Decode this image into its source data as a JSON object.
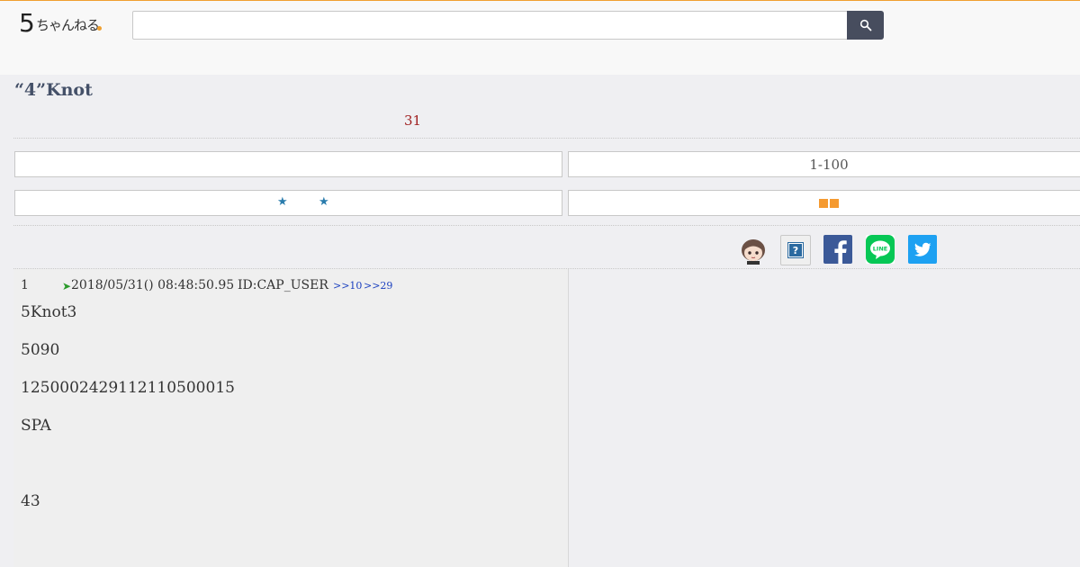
{
  "header": {
    "logo_five": "5",
    "logo_text": "ちゃんねる",
    "search_placeholder": "",
    "search_icon": "search-icon"
  },
  "thread": {
    "title": "“4”Knot",
    "count": "31"
  },
  "nav": {
    "range_label": "1-100",
    "left_box_top_label": "",
    "left_box_bottom_stars": [
      "★",
      "★"
    ]
  },
  "share": {
    "icons": [
      "avatar-icon",
      "help-icon",
      "facebook-icon",
      "line-icon",
      "twitter-icon"
    ],
    "line_label": "LINE"
  },
  "post": {
    "number": "1",
    "datetime": "2018/05/31() 08:48:50.95",
    "id": "ID:CAP_USER",
    "replies": [
      ">>10",
      ">>29"
    ],
    "lines": [
      "5Knot3",
      "5090",
      "125000242911211050​0015",
      "SPA",
      "",
      "43"
    ]
  },
  "colors": {
    "accent": "#f0a030",
    "title": "#445068",
    "count": "#a02020",
    "link": "#1a3fbf",
    "star": "#2a7cad",
    "facebook": "#3b5998",
    "line": "#06c755",
    "twitter": "#1da1f2"
  }
}
